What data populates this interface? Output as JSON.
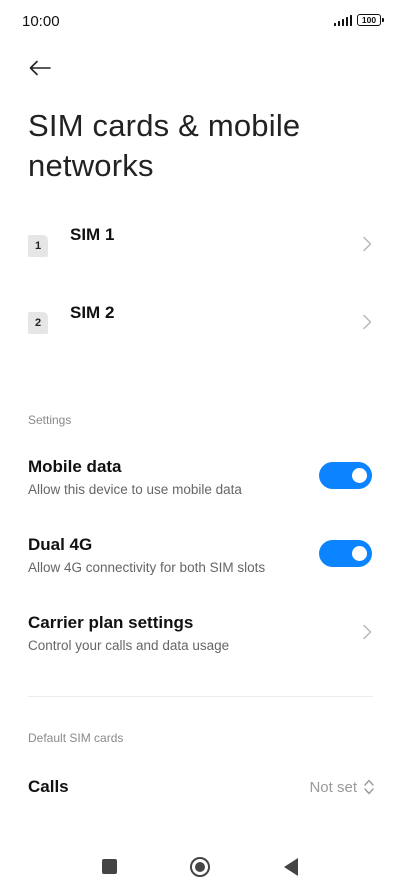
{
  "status_bar": {
    "time": "10:00",
    "battery": "100"
  },
  "header": {
    "back_icon": "arrow-left-icon",
    "title": "SIM cards & mobile networks"
  },
  "sims": [
    {
      "badge": "1",
      "label": "SIM 1"
    },
    {
      "badge": "2",
      "label": "SIM 2"
    }
  ],
  "settings_section": {
    "label": "Settings",
    "mobile_data": {
      "title": "Mobile data",
      "subtitle": "Allow this device to use mobile data",
      "enabled": true
    },
    "dual_4g": {
      "title": "Dual 4G",
      "subtitle": "Allow 4G connectivity for both SIM slots",
      "enabled": true
    },
    "carrier_plan": {
      "title": "Carrier plan settings",
      "subtitle": "Control your calls and data usage"
    }
  },
  "default_sim_section": {
    "label": "Default SIM cards",
    "calls": {
      "title": "Calls",
      "value": "Not set"
    }
  },
  "colors": {
    "accent": "#0d84ff",
    "secondary_text": "#666666",
    "section_label": "#8a8a8a"
  }
}
